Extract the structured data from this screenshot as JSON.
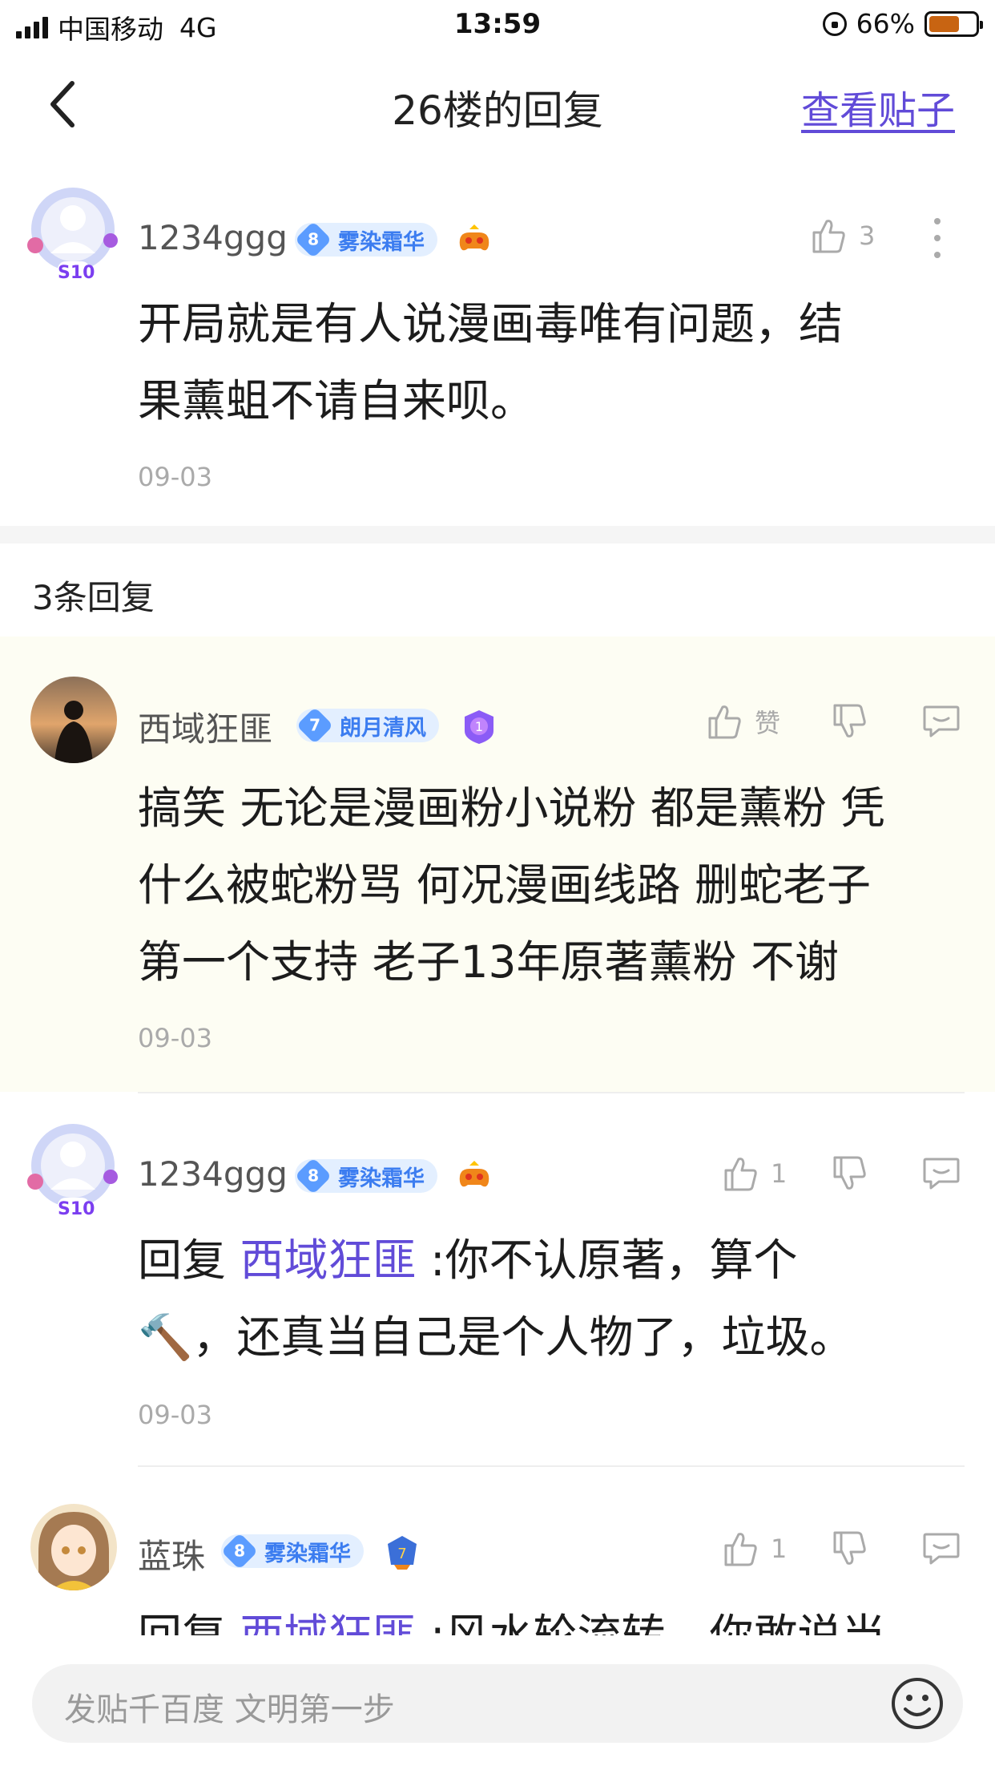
{
  "status_bar": {
    "carrier": "中国移动",
    "network": "4G",
    "time": "13:59",
    "battery": "66%",
    "battery_level": 0.66
  },
  "nav": {
    "title": "26楼的回复",
    "view_post": "查看贴子"
  },
  "main_comment": {
    "username": "1234ggg",
    "level": "8",
    "level_name": "雾染霜华",
    "avatar_badge": "S10",
    "like_count": "3",
    "content_lines": [
      "开局就是有人说漫画毒唯有问题，结",
      "果薰蛆不请自来呗。"
    ],
    "date": "09-03"
  },
  "replies_header": "3条回复",
  "replies": [
    {
      "username": "西域狂匪",
      "level": "7",
      "level_name": "朗月清风",
      "like_label": "赞",
      "content_lines": [
        "搞笑 无论是漫画粉小说粉 都是薰粉 凭",
        "什么被蛇粉骂 何况漫画线路 删蛇老子",
        "第一个支持 老子13年原著薰粉 不谢"
      ],
      "date": "09-03"
    },
    {
      "username": "1234ggg",
      "level": "8",
      "level_name": "雾染霜华",
      "avatar_badge": "S10",
      "like_label": "1",
      "reply_prefix": "回复 ",
      "mention": "西域狂匪",
      "content_rest": " :你不认原著，算个",
      "content_line2": "🔨，还真当自己是个人物了，垃圾。",
      "date": "09-03"
    },
    {
      "username": "蓝珠",
      "level": "8",
      "level_name": "雾染霜华",
      "like_label": "1",
      "reply_prefix": "回复 ",
      "mention": "西域狂匪",
      "content_rest": " :风水轮流转，你敢说当"
    }
  ],
  "input": {
    "placeholder": "发贴千百度 文明第一步"
  },
  "colors": {
    "accent": "#614bd8",
    "badge_blue": "#5b9cff",
    "highlight_bg": "#fdfdf3"
  }
}
